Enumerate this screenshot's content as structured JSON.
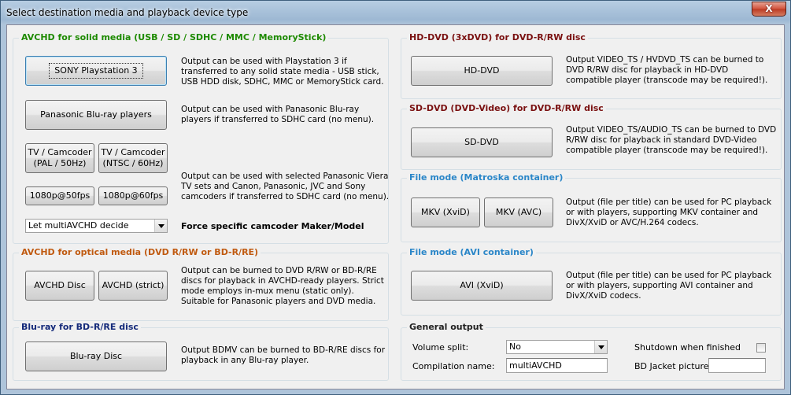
{
  "window": {
    "title": "Select destination media and playback device type",
    "close_label": "X"
  },
  "avchd_solid": {
    "title": "AVCHD for solid media (USB / SD / SDHC / MMC / MemoryStick)",
    "ps3_button": "SONY Playstation 3",
    "ps3_desc": "Output can be used with Playstation 3 if transferred to any solid state media - USB stick, USB HDD disk, SDHC, MMC or MemoryStick card.",
    "panasonic_button": "Panasonic Blu-ray players",
    "panasonic_desc": "Output can be used with Panasonic Blu-ray players if transferred to SDHC card (no menu).",
    "tv_pal_button": "TV / Camcoder (PAL / 50Hz)",
    "tv_ntsc_button": "TV / Camcoder (NTSC / 60Hz)",
    "p50_button": "1080p@50fps",
    "p60_button": "1080p@60fps",
    "camcoder_desc": "Output can be used with selected Panasonic Viera TV sets and Canon, Panasonic, JVC and Sony camcoders if transferred to SDHC card (no menu).",
    "maker_select": "Let multiAVCHD decide",
    "maker_label": "Force specific camcoder Maker/Model"
  },
  "avchd_optical": {
    "title": "AVCHD for optical media (DVD R/RW or BD-R/RE)",
    "disc_button": "AVCHD Disc",
    "strict_button": "AVCHD (strict)",
    "desc": "Output can be burned to DVD R/RW or BD-R/RE discs for playback in AVCHD-ready players. Strict mode employs in-mux menu (static only). Suitable for Panasonic players and DVD media."
  },
  "bluray": {
    "title": "Blu-ray for BD-R/RE disc",
    "button": "Blu-ray Disc",
    "desc": "Output BDMV can be burned to BD-R/RE discs for playback in any Blu-ray player."
  },
  "hddvd": {
    "title": "HD-DVD (3xDVD) for DVD-R/RW disc",
    "button": "HD-DVD",
    "desc": "Output VIDEO_TS / HVDVD_TS can be burned to DVD R/RW disc for playback in HD-DVD compatible player (transcode may be required!)."
  },
  "sddvd": {
    "title": "SD-DVD (DVD-Video) for DVD-R/RW disc",
    "button": "SD-DVD",
    "desc": "Output VIDEO_TS/AUDIO_TS can be burned to DVD R/RW disc for playback in standard DVD-Video compatible player (transcode may be required!)."
  },
  "mkv": {
    "title": "File mode (Matroska container)",
    "xvid_button": "MKV (XviD)",
    "avc_button": "MKV (AVC)",
    "desc": "Output (file per title) can be used for PC playback or with players, supporting MKV container and DivX/XviD or AVC/H.264 codecs."
  },
  "avi": {
    "title": "File mode (AVI container)",
    "button": "AVI (XviD)",
    "desc": "Output (file per title) can be used for PC playback or with players, supporting AVI container and DivX/XviD codecs."
  },
  "general": {
    "title": "General output",
    "volume_label": "Volume split:",
    "volume_value": "No",
    "compilation_label": "Compilation name:",
    "compilation_value": "multiAVCHD",
    "shutdown_label": "Shutdown when finished",
    "jacket_label": "BD Jacket picture:",
    "jacket_value": ""
  },
  "colors": {
    "green_title": "#1d8a00",
    "maroon_title": "#7a1111",
    "orange_title": "#c05a10",
    "blue_title": "#2a86c8",
    "navy_title": "#142a7a"
  },
  "icons": {
    "dropdown": "chevron-down-icon",
    "close": "close-icon"
  }
}
